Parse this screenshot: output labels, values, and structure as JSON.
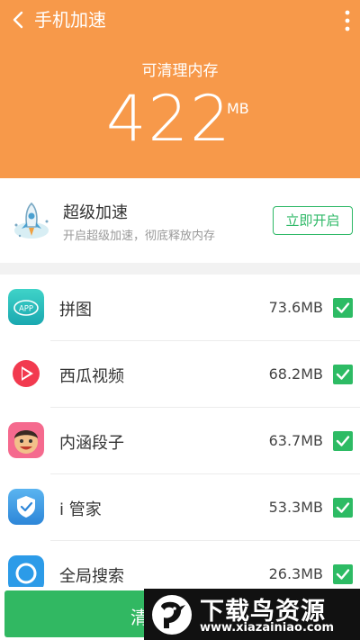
{
  "header": {
    "title": "手机加速",
    "memory_label": "可清理内存",
    "memory_value": "422",
    "memory_unit": "MB",
    "color": "#f7994a"
  },
  "boost": {
    "title": "超级加速",
    "description": "开启超级加速，彻底释放内存",
    "button_label": "立即开启",
    "icon": "rocket-icon"
  },
  "apps": [
    {
      "name": "拼图",
      "size": "73.6MB",
      "checked": true,
      "icon": "app-puzzle-icon"
    },
    {
      "name": "西瓜视频",
      "size": "68.2MB",
      "checked": true,
      "icon": "xigua-video-icon"
    },
    {
      "name": "内涵段子",
      "size": "63.7MB",
      "checked": true,
      "icon": "neihan-icon"
    },
    {
      "name": "i 管家",
      "size": "53.3MB",
      "checked": true,
      "icon": "shield-check-icon"
    },
    {
      "name": "全局搜索",
      "size": "26.3MB",
      "checked": true,
      "icon": "global-search-icon"
    }
  ],
  "bottom": {
    "clean_label": "清",
    "accent": "#31b862"
  },
  "watermark": {
    "title": "下载鸟资源",
    "url": "www.xiazainiao.com"
  }
}
